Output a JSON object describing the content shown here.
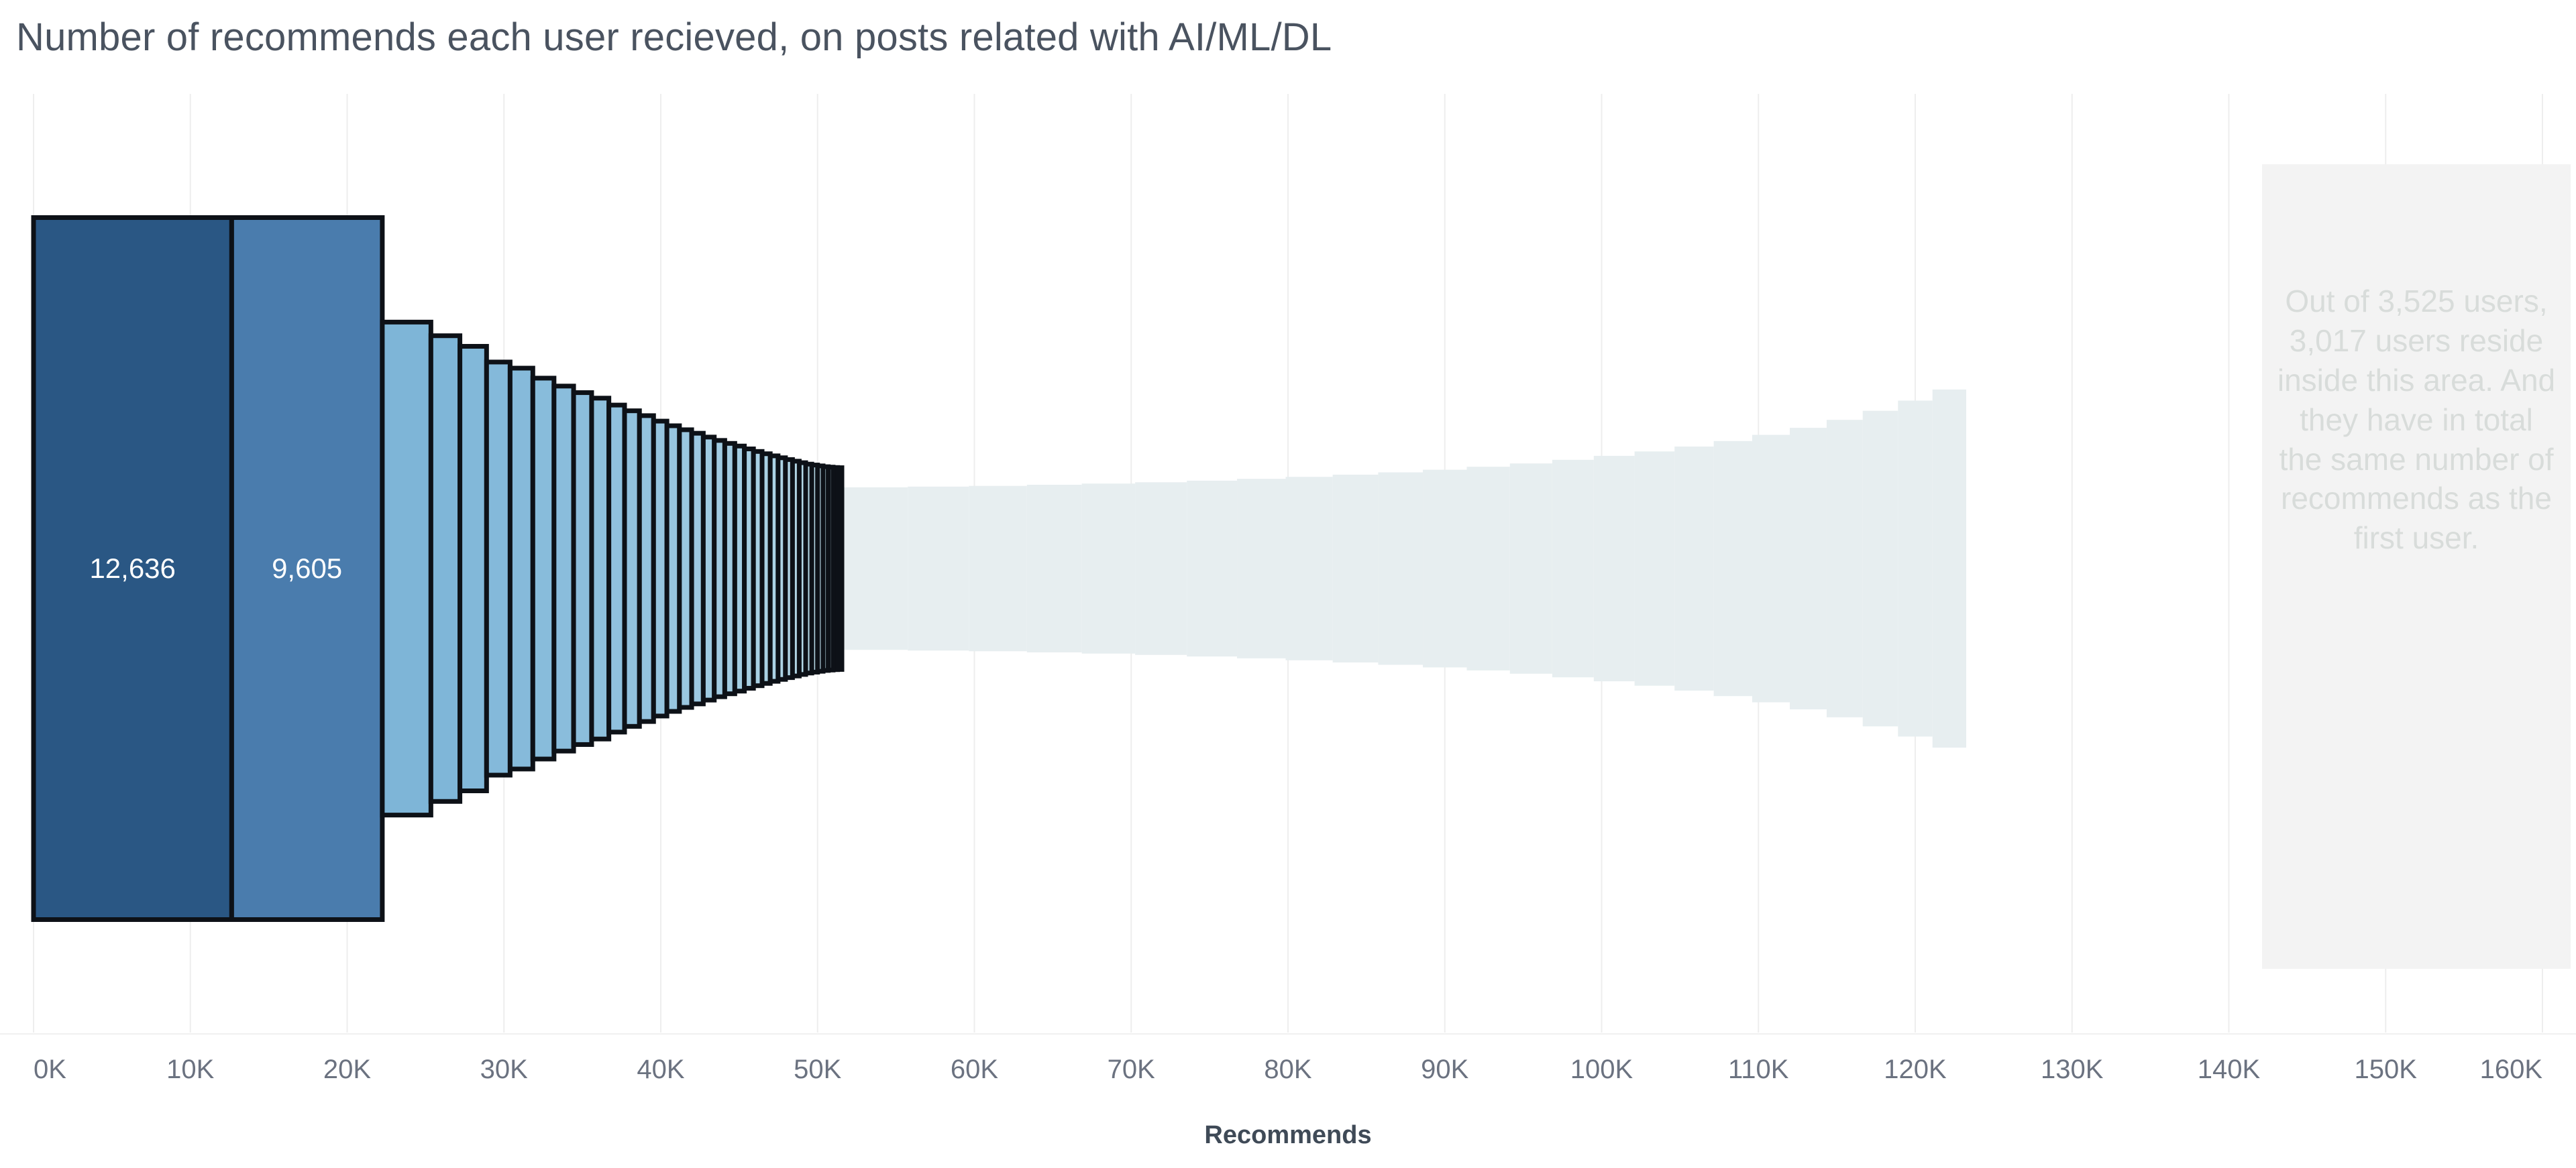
{
  "chart": {
    "title": "Number of recommends each user recieved, on posts related with AI/ML/DL",
    "axis_title": "Recommends",
    "annotation": "Out of 3,525 users, 3,017 users reside inside this area. And they have in total the same number of recommends as the first user.",
    "label_first": "12,636",
    "label_second": "9,605",
    "colors": {
      "bar_darkest": "#2a5784",
      "bar_second": "#4a7cad",
      "bar_light": "#8fc0de",
      "bar_faded": "#e7eef0",
      "outline": "#0d1117",
      "gridline": "#eeeeee",
      "annotation_bg": "#f3f3f3",
      "annotation_text": "#d8dcda",
      "title_text": "#4a5360",
      "tick_text": "#6b7280"
    }
  },
  "chart_data": {
    "type": "bar",
    "title": "Number of recommends each user recieved, on posts related with AI/ML/DL",
    "subtitle": "",
    "xlabel": "Recommends",
    "ylabel": "",
    "xlim": [
      0,
      160000
    ],
    "ylim": [
      0,
      3525
    ],
    "grid": true,
    "legend": false,
    "orientation": "horizontal-cumulative-funnel",
    "description": "Each segment is one user (or group of users) drawn as a vertically centred rectangle. Segment width = that user's recommend count (cumulative along the x axis); segment height = number of users represented, so the tallest left-most block is the single top user.",
    "x_ticks": [
      "0K",
      "10K",
      "20K",
      "30K",
      "40K",
      "50K",
      "60K",
      "70K",
      "80K",
      "90K",
      "100K",
      "110K",
      "120K",
      "130K",
      "140K",
      "150K",
      "160K"
    ],
    "x_tick_values": [
      0,
      10000,
      20000,
      30000,
      40000,
      50000,
      60000,
      70000,
      80000,
      90000,
      100000,
      110000,
      120000,
      130000,
      140000,
      150000,
      160000
    ],
    "annotations": [
      {
        "text": "Out of 3,525 users, 3,017 users reside inside this area. And they have in total the same number of recommends as the first user.",
        "x_start": 144000,
        "x_end": 160000
      }
    ],
    "data_labels": [
      {
        "text": "12,636",
        "segment_index": 0
      },
      {
        "text": "9,605",
        "segment_index": 1
      }
    ],
    "total_users": 3525,
    "users_in_tail": 3017,
    "segments": [
      {
        "recommends": 12636,
        "users": 1,
        "label": "12,636",
        "color": "#2a5784"
      },
      {
        "recommends": 9605,
        "users": 1,
        "label": "9,605",
        "color": "#4a7cad"
      },
      {
        "recommends": 3100,
        "users": 4,
        "label": null,
        "color": "#7eb5d7"
      },
      {
        "recommends": 1850,
        "users": 5,
        "label": null,
        "color": "#7fb6d8"
      },
      {
        "recommends": 1700,
        "users": 6,
        "label": null,
        "color": "#82b8d9"
      },
      {
        "recommends": 1500,
        "users": 8,
        "label": null,
        "color": "#84b9da"
      },
      {
        "recommends": 1450,
        "users": 9,
        "label": null,
        "color": "#86bada"
      },
      {
        "recommends": 1350,
        "users": 11,
        "label": null,
        "color": "#88bcdb"
      },
      {
        "recommends": 1250,
        "users": 13,
        "label": null,
        "color": "#8abddc"
      },
      {
        "recommends": 1150,
        "users": 15,
        "label": null,
        "color": "#8cbedc"
      },
      {
        "recommends": 1100,
        "users": 17,
        "label": null,
        "color": "#8ec0dd"
      },
      {
        "recommends": 1000,
        "users": 20,
        "label": null,
        "color": "#90c1de"
      },
      {
        "recommends": 950,
        "users": 23,
        "label": null,
        "color": "#92c2de"
      },
      {
        "recommends": 900,
        "users": 26,
        "label": null,
        "color": "#94c3df"
      },
      {
        "recommends": 850,
        "users": 30,
        "label": null,
        "color": "#96c5df"
      },
      {
        "recommends": 800,
        "users": 34,
        "label": null,
        "color": "#98c6e0"
      },
      {
        "recommends": 780,
        "users": 38,
        "label": null,
        "color": "#9ac7e0"
      },
      {
        "recommends": 740,
        "users": 42,
        "label": null,
        "color": "#9cc8e1"
      },
      {
        "recommends": 700,
        "users": 47,
        "label": null,
        "color": "#9ecae1"
      },
      {
        "recommends": 670,
        "users": 52,
        "label": null,
        "color": "#a0cbe2"
      },
      {
        "recommends": 640,
        "users": 57,
        "label": null,
        "color": "#a2cce2"
      },
      {
        "recommends": 610,
        "users": 62,
        "label": null,
        "color": "#a4cee3"
      },
      {
        "recommends": 580,
        "users": 68,
        "label": null,
        "color": "#a6cfe3"
      },
      {
        "recommends": 550,
        "users": 74,
        "label": null,
        "color": "#a8d0e4"
      },
      {
        "recommends": 520,
        "users": 80,
        "label": null,
        "color": "#aad2e4"
      },
      {
        "recommends": 500,
        "users": 86,
        "label": null,
        "color": "#acd3e5"
      },
      {
        "recommends": 470,
        "users": 92,
        "label": null,
        "color": "#aed4e5"
      },
      {
        "recommends": 450,
        "users": 98,
        "label": null,
        "color": "#b0d6e6"
      },
      {
        "recommends": 430,
        "users": 104,
        "label": null,
        "color": "#b2d7e6"
      },
      {
        "recommends": 410,
        "users": 110,
        "label": null,
        "color": "#b4d8e7"
      },
      {
        "recommends": 390,
        "users": 116,
        "label": null,
        "color": "#b6dae7"
      },
      {
        "recommends": 370,
        "users": 120,
        "label": null,
        "color": "#b8dbe8"
      },
      {
        "recommends": 350,
        "users": 124,
        "label": null,
        "color": "#badce8"
      },
      {
        "recommends": 330,
        "users": 128,
        "label": null,
        "color": "#bcdee9"
      },
      {
        "recommends": 310,
        "users": 130,
        "label": null,
        "color": "#bedfe9"
      },
      {
        "recommends": 290,
        "users": 132,
        "label": null,
        "color": "#c0e0ea"
      },
      {
        "recommends": 270,
        "users": 133,
        "label": null,
        "color": "#c2e1ea"
      }
    ],
    "tail_segments": [
      {
        "recommends": 4200,
        "users": 310
      },
      {
        "recommends": 3900,
        "users": 300
      },
      {
        "recommends": 3700,
        "users": 290
      },
      {
        "recommends": 3500,
        "users": 275
      },
      {
        "recommends": 3400,
        "users": 260
      },
      {
        "recommends": 3300,
        "users": 245
      },
      {
        "recommends": 3200,
        "users": 228
      },
      {
        "recommends": 3100,
        "users": 210
      },
      {
        "recommends": 3000,
        "users": 193
      },
      {
        "recommends": 2900,
        "users": 176
      },
      {
        "recommends": 2850,
        "users": 160
      },
      {
        "recommends": 2800,
        "users": 144
      },
      {
        "recommends": 2750,
        "users": 128
      },
      {
        "recommends": 2700,
        "users": 113
      },
      {
        "recommends": 2650,
        "users": 99
      },
      {
        "recommends": 2600,
        "users": 86
      },
      {
        "recommends": 2550,
        "users": 74
      },
      {
        "recommends": 2500,
        "users": 63
      },
      {
        "recommends": 2450,
        "users": 53
      },
      {
        "recommends": 2400,
        "users": 44
      },
      {
        "recommends": 2350,
        "users": 36
      },
      {
        "recommends": 2300,
        "users": 29
      },
      {
        "recommends": 2250,
        "users": 23
      },
      {
        "recommends": 2200,
        "users": 18
      },
      {
        "recommends": 2150,
        "users": 14
      }
    ]
  }
}
